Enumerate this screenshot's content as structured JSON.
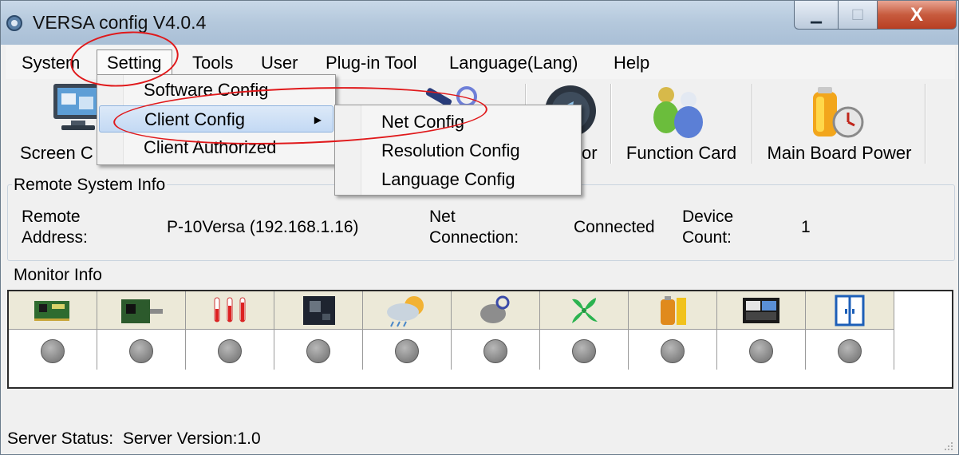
{
  "window": {
    "title": "VERSA config V4.0.4",
    "minimize_glyph": "▁",
    "maximize_glyph": "□",
    "close_glyph": "X"
  },
  "menubar": {
    "items": [
      "System",
      "Setting",
      "Tools",
      "User",
      "Plug-in Tool",
      "Language(Lang)",
      "Help"
    ]
  },
  "toolbar": {
    "buttons": [
      {
        "label": "Screen C",
        "icon": "screen-config-icon"
      },
      {
        "label": "or",
        "icon": "monitor-icon"
      },
      {
        "label": "Function Card",
        "icon": "function-card-icon"
      },
      {
        "label": "Main Board Power",
        "icon": "main-board-power-icon"
      }
    ]
  },
  "setting_menu": {
    "items": [
      "Software Config",
      "Client Config",
      "Client Authorized"
    ],
    "submenu_arrow": "▶"
  },
  "client_config_submenu": {
    "items": [
      "Net Config",
      "Resolution Config",
      "Language Config"
    ]
  },
  "remote_system_info": {
    "title": "Remote System Info",
    "remote_address_label_1": "Remote",
    "remote_address_label_2": "Address:",
    "remote_address_value": "P-10Versa (192.168.1.16)",
    "net_connection_label_1": "Net",
    "net_connection_label_2": "Connection:",
    "net_connection_value": "Connected",
    "device_count_label_1": "Device",
    "device_count_label_2": "Count:",
    "device_count_value": "1"
  },
  "monitor_info": {
    "title": "Monitor Info",
    "columns": [
      "receiving-card-icon",
      "sending-card-icon",
      "thermometer-icon",
      "chip-icon",
      "weather-icon",
      "smoke-icon",
      "fan-icon",
      "battery-icon",
      "display-panel-icon",
      "door-icon"
    ],
    "led_color": "#8a8a8a"
  },
  "status_bar": {
    "server_status_label": "Server Status:",
    "server_version": "Server Version:1.0"
  },
  "colors": {
    "annotation_red": "#e0191b",
    "highlight": "#c3d9f4"
  }
}
